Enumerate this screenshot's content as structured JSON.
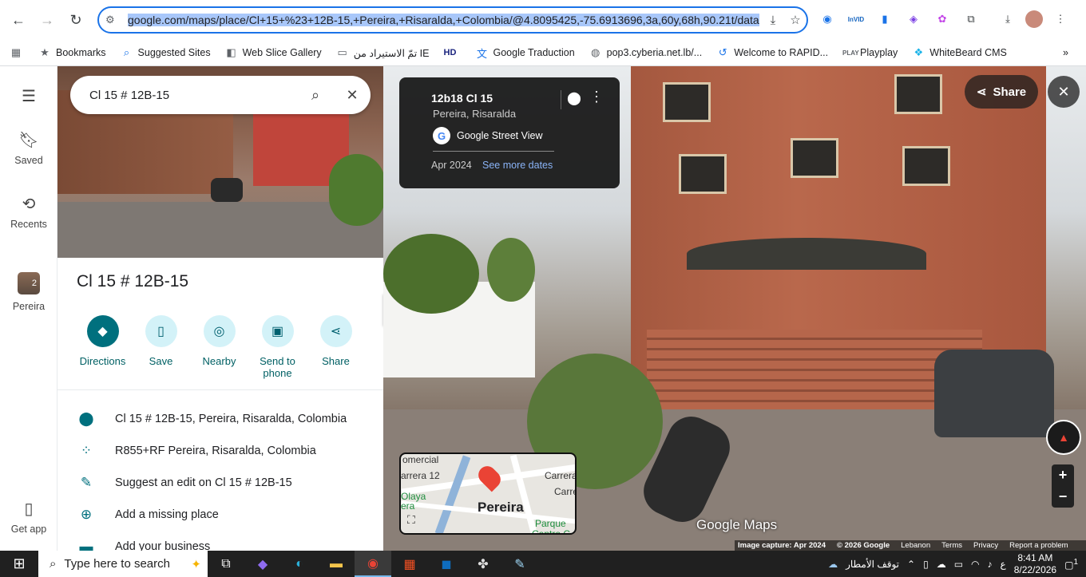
{
  "browser": {
    "url": "google.com/maps/place/Cl+15+%23+12B-15,+Pereira,+Risaralda,+Colombia/@4.8095425,-75.6913696,3a,60y,68h,90.21t/data",
    "bookmarks": [
      {
        "label": "Bookmarks",
        "icon": "star-icon"
      },
      {
        "label": "Suggested Sites",
        "icon": "search-icon"
      },
      {
        "label": "Web Slice Gallery",
        "icon": "webslice-icon"
      },
      {
        "label": "تمّ الاستيراد من IE",
        "icon": "folder-icon"
      },
      {
        "label": "",
        "icon": "hd-icon"
      },
      {
        "label": "Google Traduction",
        "icon": "translate-icon"
      },
      {
        "label": "pop3.cyberia.net.lb/...",
        "icon": "globe-icon"
      },
      {
        "label": "Welcome to RAPID...",
        "icon": "rapid-icon"
      },
      {
        "label": "Playplay",
        "icon": "playplay-icon"
      },
      {
        "label": "WhiteBeard CMS",
        "icon": "whitebeard-icon"
      }
    ]
  },
  "rail": {
    "saved": "Saved",
    "recents": "Recents",
    "pereira": "Pereira",
    "pereira_count": "2",
    "get_app": "Get app"
  },
  "panel": {
    "search_value": "Cl 15 # 12B-15",
    "title": "Cl 15 # 12B-15",
    "actions": [
      {
        "label": "Directions"
      },
      {
        "label": "Save"
      },
      {
        "label": "Nearby"
      },
      {
        "label": "Send to phone"
      },
      {
        "label": "Share"
      }
    ],
    "info": [
      {
        "text": "Cl 15 # 12B-15, Pereira, Risaralda, Colombia",
        "icon": "location-pin-icon"
      },
      {
        "text": "R855+RF Pereira, Risaralda, Colombia",
        "icon": "plus-code-icon"
      },
      {
        "text": "Suggest an edit on Cl 15 # 12B-15",
        "icon": "pencil-icon"
      },
      {
        "text": "Add a missing place",
        "icon": "add-place-icon"
      },
      {
        "text": "Add your business",
        "icon": "business-icon"
      }
    ]
  },
  "streetview": {
    "card": {
      "title": "12b18 Cl 15",
      "subtitle": "Pereira, Risaralda",
      "service": "Google Street View",
      "date": "Apr 2024",
      "more_dates": "See more dates"
    },
    "share": "Share",
    "minimap": {
      "city": "Pereira",
      "labels": [
        "omercial",
        "arrera 12",
        "Carrera",
        "Carre",
        "Olaya",
        "era",
        "Parque",
        "Centro C"
      ]
    },
    "watermark": "Google Maps",
    "footer": {
      "capture": "Image capture: Apr 2024",
      "copyright": "© 2026 Google",
      "region": "Lebanon",
      "terms": "Terms",
      "privacy": "Privacy",
      "report": "Report a problem"
    }
  },
  "taskbar": {
    "search_placeholder": "Type here to search",
    "weather": "توقف الأمطار",
    "lang": "ع",
    "time": "8:41 AM",
    "date": "8/22/2026",
    "notif_count": "1"
  }
}
